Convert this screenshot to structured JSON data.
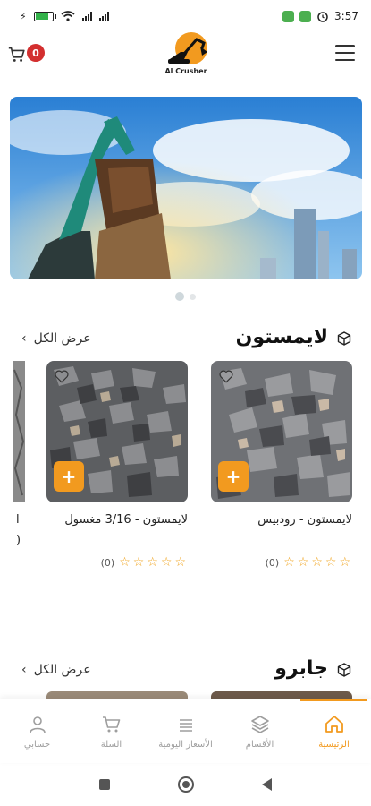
{
  "status_bar": {
    "time": "3:57"
  },
  "header": {
    "cart_count": "0",
    "logo_text": "Al Crusher"
  },
  "banner": {
    "slide_count": 2,
    "active_slide": 1
  },
  "sections": [
    {
      "title": "لايمستون",
      "view_all": "عرض الكل",
      "products": [
        {
          "name": "لايمستون - رودبيس",
          "rating_count": "(0)"
        },
        {
          "name": "لايمستون - 3/16 مغسول",
          "rating_count": "(0)"
        }
      ]
    },
    {
      "title": "جابرو",
      "view_all": "عرض الكل"
    }
  ],
  "bottom_nav": [
    {
      "label": "الرئيسية",
      "icon": "home-icon",
      "active": true
    },
    {
      "label": "الأقسام",
      "icon": "layers-icon",
      "active": false
    },
    {
      "label": "الأسعار اليومية",
      "icon": "list-icon",
      "active": false
    },
    {
      "label": "السلة",
      "icon": "cart-icon",
      "active": false
    },
    {
      "label": "حسابي",
      "icon": "user-icon",
      "active": false
    }
  ],
  "colors": {
    "accent": "#f29a1f",
    "badge": "#d32f2f"
  }
}
